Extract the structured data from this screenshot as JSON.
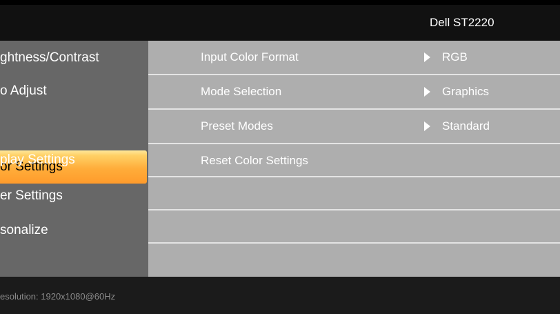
{
  "header": {
    "model": "Dell ST2220"
  },
  "left_menu": {
    "items": [
      {
        "label": "ghtness/Contrast"
      },
      {
        "label": "o Adjust"
      },
      {
        "label": "or Settings"
      },
      {
        "label": "play Settings"
      },
      {
        "label": "er Settings"
      },
      {
        "label": "sonalize"
      }
    ]
  },
  "right_panel": {
    "rows": [
      {
        "label": "Input Color Format",
        "value": "RGB"
      },
      {
        "label": "Mode Selection",
        "value": "Graphics"
      },
      {
        "label": "Preset Modes",
        "value": "Standard"
      },
      {
        "label": "Reset Color Settings"
      }
    ]
  },
  "footer": {
    "resolution": "esolution:  1920x1080@60Hz"
  },
  "colors": {
    "selection_top": "#ffe79a",
    "selection_bottom": "#ff9b2b",
    "left_bg": "#676767",
    "panel_bg": "#aeaeae"
  }
}
